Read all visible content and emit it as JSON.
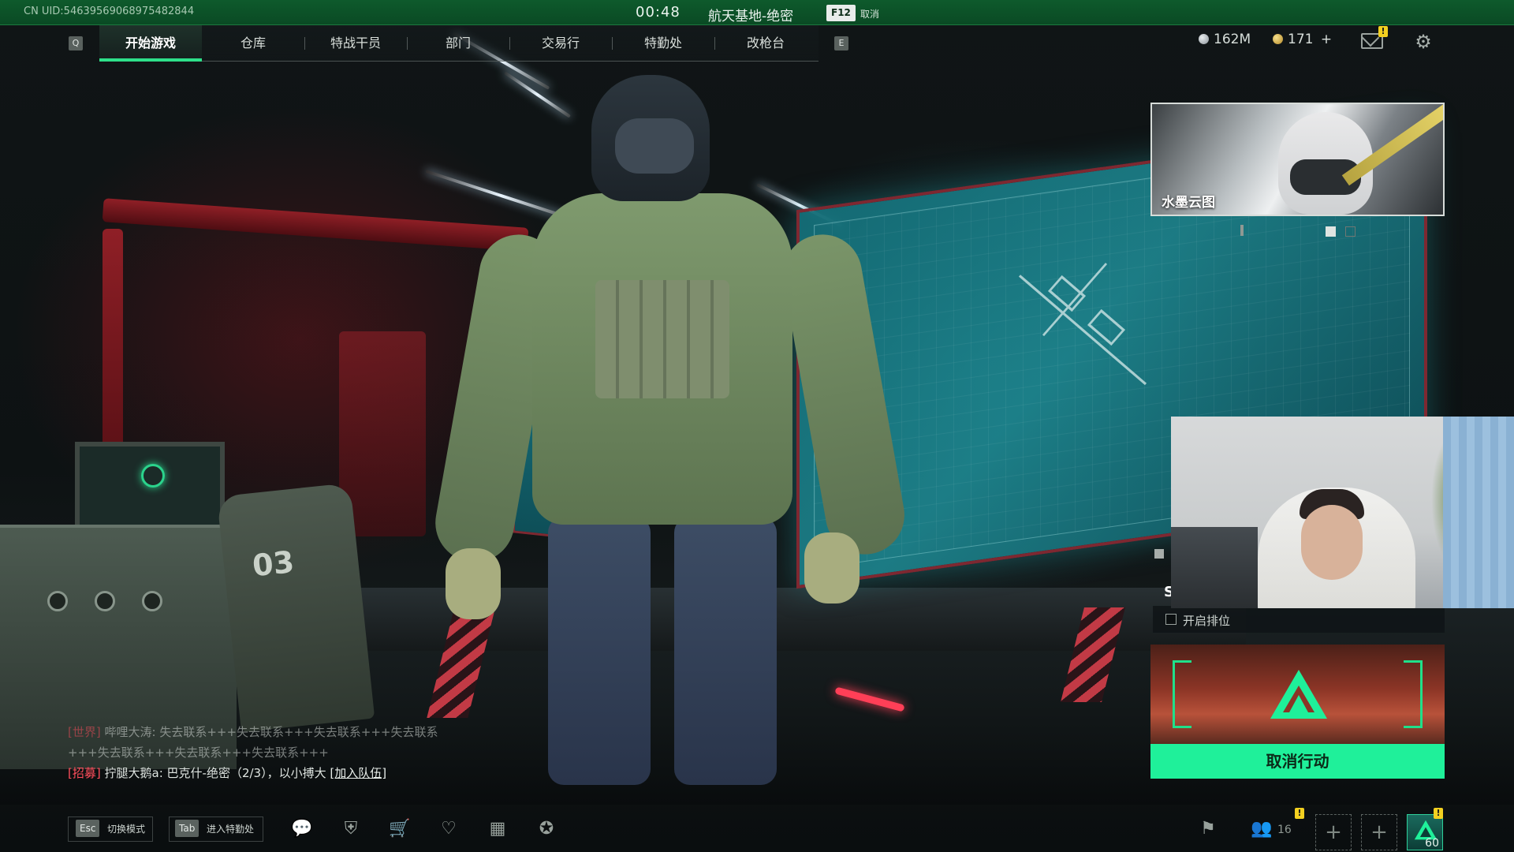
{
  "system_bar": {
    "uid": "CN UID:5463956906897548284​4",
    "timer": "00:48",
    "map_name": "航天基地-绝密",
    "cancel_key": "F12",
    "cancel_label": "取消"
  },
  "nav": {
    "prev_key": "Q",
    "next_key": "E",
    "tabs": [
      {
        "label": "开始游戏",
        "active": true
      },
      {
        "label": "仓库",
        "active": false
      },
      {
        "label": "特战干员",
        "active": false
      },
      {
        "label": "部门",
        "active": false
      },
      {
        "label": "交易行",
        "active": false
      },
      {
        "label": "特勤处",
        "active": false
      },
      {
        "label": "改枪台",
        "active": false
      }
    ]
  },
  "currency": {
    "silver": "162M",
    "gold": "171",
    "gold_add": "+"
  },
  "header_badges": {
    "mail_badge": "!"
  },
  "event_banner": {
    "title": "水墨云图"
  },
  "queue_panel": {
    "mode_letter": "S",
    "ranked_label": "开启排位",
    "ranked_checked": false,
    "cancel_button": "取消行动"
  },
  "chat": {
    "world_tag": "[世界]",
    "world_sender": "哔哩大涛:",
    "world_message": "失去联系+++失去联系+++失去联系+++失去联系+++失去联系+++失去联系+++失去联系+++",
    "recruit_tag": "[招募]",
    "recruit_sender": "拧腿大鹅a:",
    "recruit_message": "巴克什-绝密（2/3），以小搏大",
    "recruit_join": "[加入队伍]"
  },
  "bottom_bar": {
    "esc_key": "Esc",
    "esc_label": "切换模式",
    "tab_key": "Tab",
    "tab_label": "进入特勤处",
    "friend_count": "16",
    "slot_add": "+",
    "level": "60",
    "badge": "!"
  },
  "colors": {
    "accent_green": "#1ff09a",
    "topbar_green": "#0e5a2c",
    "chat_red": "#ff4e5c",
    "badge_yellow": "#f3d020"
  }
}
